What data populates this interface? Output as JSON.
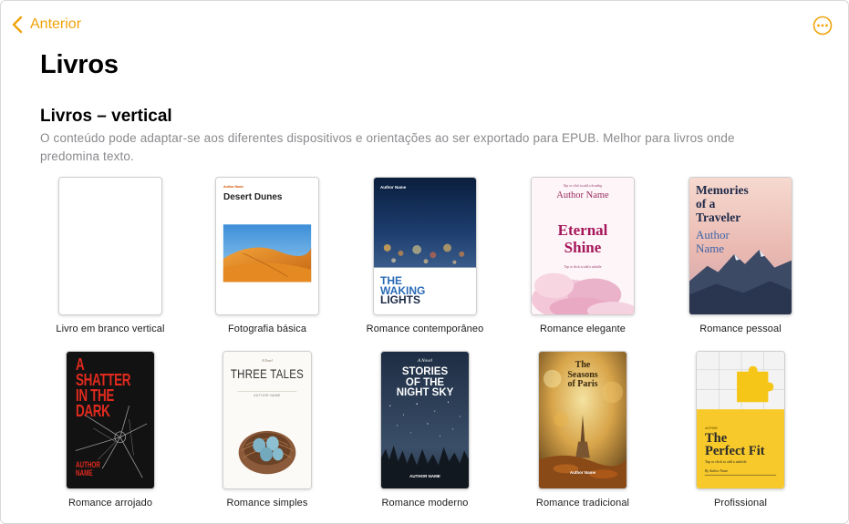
{
  "nav": {
    "back_label": "Anterior",
    "more_icon": "ellipsis-circle-icon"
  },
  "page": {
    "title": "Livros"
  },
  "section": {
    "title": "Livros – vertical",
    "description": "O conteúdo pode adaptar-se aos diferentes dispositivos e orientações ao ser exportado para EPUB. Melhor para livros onde predomina texto."
  },
  "colors": {
    "accent": "#f0a30a",
    "secondary_text": "#8a8a8e"
  },
  "templates": [
    {
      "label": "Livro em branco vertical"
    },
    {
      "label": "Fotografia básica",
      "cover": {
        "author": "Author Name",
        "title": "Desert Dunes"
      }
    },
    {
      "label": "Romance contemporâneo",
      "cover": {
        "author": "Author Name",
        "title_line1": "THE",
        "title_line2": "WAKING",
        "title_line3": "LIGHTS"
      }
    },
    {
      "label": "Romance elegante",
      "cover": {
        "hint": "Tap or click to add a heading",
        "author": "Author Name",
        "title_line1": "Eternal",
        "title_line2": "Shine",
        "subtitle_hint": "Tap or click to add a subtitle"
      }
    },
    {
      "label": "Romance pessoal",
      "cover": {
        "title_line1": "Memories",
        "title_line2": "of a",
        "title_line3": "Traveler",
        "author_line1": "Author",
        "author_line2": "Name"
      }
    },
    {
      "label": "Romance arrojado",
      "cover": {
        "title_line1": "A",
        "title_line2": "SHATTER",
        "title_line3": "IN THE",
        "title_line4": "DARK",
        "author_line1": "AUTHOR",
        "author_line2": "NAME"
      }
    },
    {
      "label": "Romance simples",
      "cover": {
        "kicker": "A Novel",
        "title": "THREE TALES",
        "author": "AUTHOR NAME"
      }
    },
    {
      "label": "Romance moderno",
      "cover": {
        "kicker": "A Novel",
        "title_line1": "STORIES",
        "title_line2": "OF THE",
        "title_line3": "NIGHT SKY",
        "author": "AUTHOR NAME"
      }
    },
    {
      "label": "Romance tradicional",
      "cover": {
        "title_line1": "The",
        "title_line2": "Seasons",
        "title_line3": "of Paris",
        "author": "Author Name"
      }
    },
    {
      "label": "Profissional",
      "cover": {
        "tag": "AUTHOR",
        "title_line1": "The",
        "title_line2": "Perfect Fit",
        "hint": "Tap or click to add a subtitle",
        "author": "By Author Name"
      }
    }
  ]
}
